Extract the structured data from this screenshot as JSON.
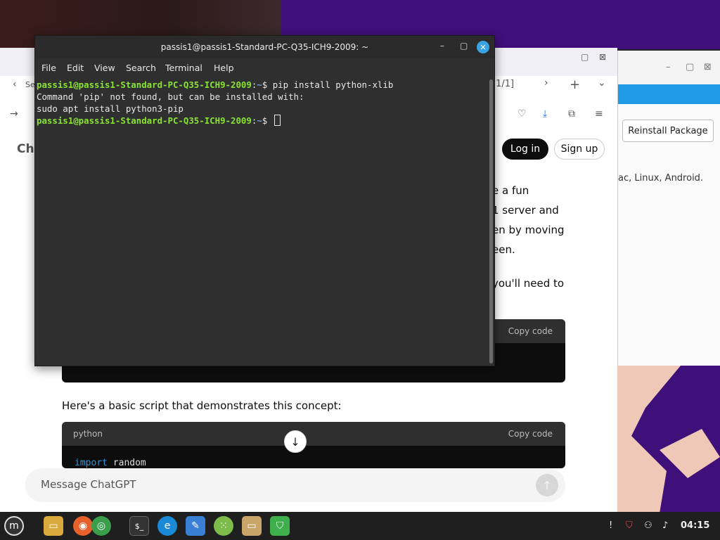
{
  "terminal": {
    "title": "passis1@passis1-Standard-PC-Q35-ICH9-2009: ~",
    "menu": [
      "File",
      "Edit",
      "View",
      "Search",
      "Terminal",
      "Help"
    ],
    "lines": [
      {
        "prompt": "passis1@passis1-Standard-PC-Q35-ICH9-2009",
        "path": "~",
        "cmd": "$ pip install python-xlib"
      },
      {
        "text": "Command 'pip' not found, but can be installed with:"
      },
      {
        "text": "sudo apt install python3-pip"
      },
      {
        "prompt": "passis1@passis1-Standard-PC-Q35-ICH9-2009",
        "path": "~",
        "cmd": "$ "
      }
    ]
  },
  "browser": {
    "tab_counter": "[1/1]",
    "login_label": "Log in",
    "signup_label": "Sign up",
    "partial_header": "Ch",
    "partial_tab": "Se",
    "fragments": [
      "e a fun",
      "1 server and",
      "en by moving",
      "een.",
      "you'll need to"
    ],
    "codeblock1": {
      "copy": "Copy code"
    },
    "intro_text": "Here's a basic script that demonstrates this concept:",
    "codeblock2": {
      "lang": "python",
      "copy": "Copy code",
      "line_kw": "import",
      "line_rest": " random"
    },
    "message_placeholder": "Message ChatGPT"
  },
  "package_window": {
    "reinstall_label": "Reinstall Package",
    "os_text": "ac, Linux, Android."
  },
  "taskbar": {
    "clock": "04:15",
    "icons": [
      "mint-menu-icon",
      "files-icon",
      "firefox-icon",
      "chrome-icon",
      "terminal-icon",
      "edge-dev-icon",
      "text-editor-icon",
      "app-grid-icon",
      "folder-icon",
      "shield-icon"
    ]
  }
}
